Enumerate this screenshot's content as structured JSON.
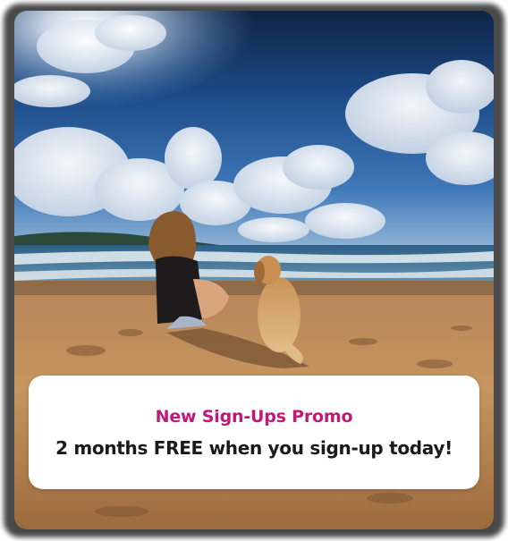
{
  "promo": {
    "title": "New Sign-Ups Promo",
    "message": "2 months FREE when you sign-up today!"
  },
  "colors": {
    "accent": "#c2187a",
    "text": "#1a1a1a",
    "card_background": "#ffffff"
  },
  "image": {
    "subject": "beach-scene"
  }
}
